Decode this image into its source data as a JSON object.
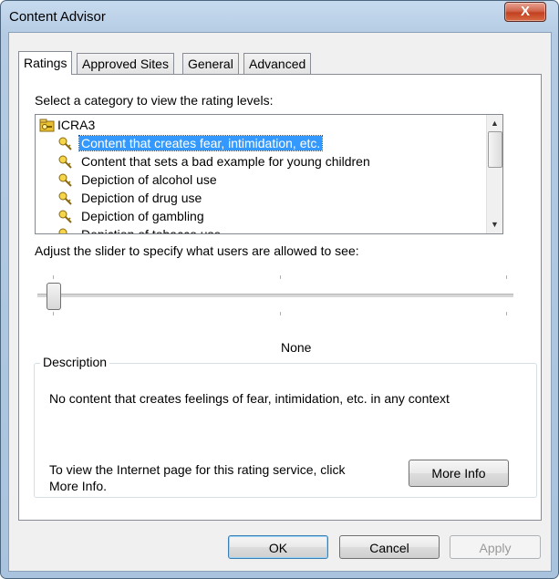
{
  "window": {
    "title": "Content Advisor",
    "close_glyph": "X"
  },
  "tabs": [
    {
      "label": "Ratings",
      "active": true
    },
    {
      "label": "Approved Sites",
      "active": false
    },
    {
      "label": "General",
      "active": false
    },
    {
      "label": "Advanced",
      "active": false
    }
  ],
  "ratings": {
    "category_prompt": "Select a category to view the rating levels:",
    "tree": {
      "root": "ICRA3",
      "items": [
        "Content that creates fear, intimidation, etc.",
        "Content that sets a bad example for young children",
        "Depiction of alcohol use",
        "Depiction of drug use",
        "Depiction of gambling",
        "Depiction of tobacco use"
      ],
      "selected_index": 0
    },
    "slider_prompt": "Adjust the slider to specify what users are allowed to see:",
    "slider_level": 0,
    "level_name": "None",
    "description": {
      "legend": "Description",
      "text": "No content that creates feelings of fear, intimidation, etc. in any context",
      "info_line1": "To view the Internet page for this rating service, click",
      "info_line2": "More Info.",
      "more_info_label": "More Info"
    }
  },
  "buttons": {
    "ok": "OK",
    "cancel": "Cancel",
    "apply": "Apply"
  },
  "icons": {
    "root": "ratings-folder-icon",
    "item": "key-icon"
  },
  "colors": {
    "selection": "#3399ff",
    "close_button": "#c2401f"
  }
}
